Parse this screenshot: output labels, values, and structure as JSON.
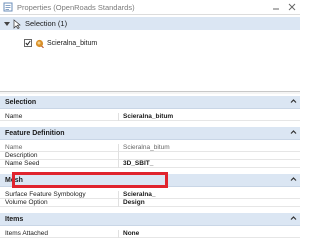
{
  "window": {
    "title": "Properties (OpenRoads Standards)",
    "selection_label": "Selection (1)",
    "element_label": "Scieralna_bitum",
    "checkbox_checked": true,
    "highlight_color": "#e0242d"
  },
  "sections": {
    "selection": {
      "title": "Selection",
      "rows": [
        {
          "name": "Name",
          "value": "Scieralna_bitum"
        }
      ]
    },
    "feature_definition": {
      "title": "Feature Definition",
      "rows": [
        {
          "name": "Name",
          "value": "Scieralna_bitum"
        },
        {
          "name": "Description",
          "value": ""
        },
        {
          "name": "Name Seed",
          "value": "3D_SBIT_"
        }
      ]
    },
    "mesh": {
      "title": "Mesh",
      "rows": [
        {
          "name": "Surface Feature Symbology",
          "value": "Scieralna_"
        },
        {
          "name": "Volume Option",
          "value": "Design"
        }
      ]
    },
    "items": {
      "title": "Items",
      "rows": [
        {
          "name": "Items Attached",
          "value": "None"
        }
      ]
    }
  },
  "icons": {
    "app": "properties-icon",
    "expand_selection": "triangle-down-icon",
    "selection": "cursor-arrow-icon",
    "element": "mesh-element-icon",
    "collapse": "chevron-up-icon"
  }
}
